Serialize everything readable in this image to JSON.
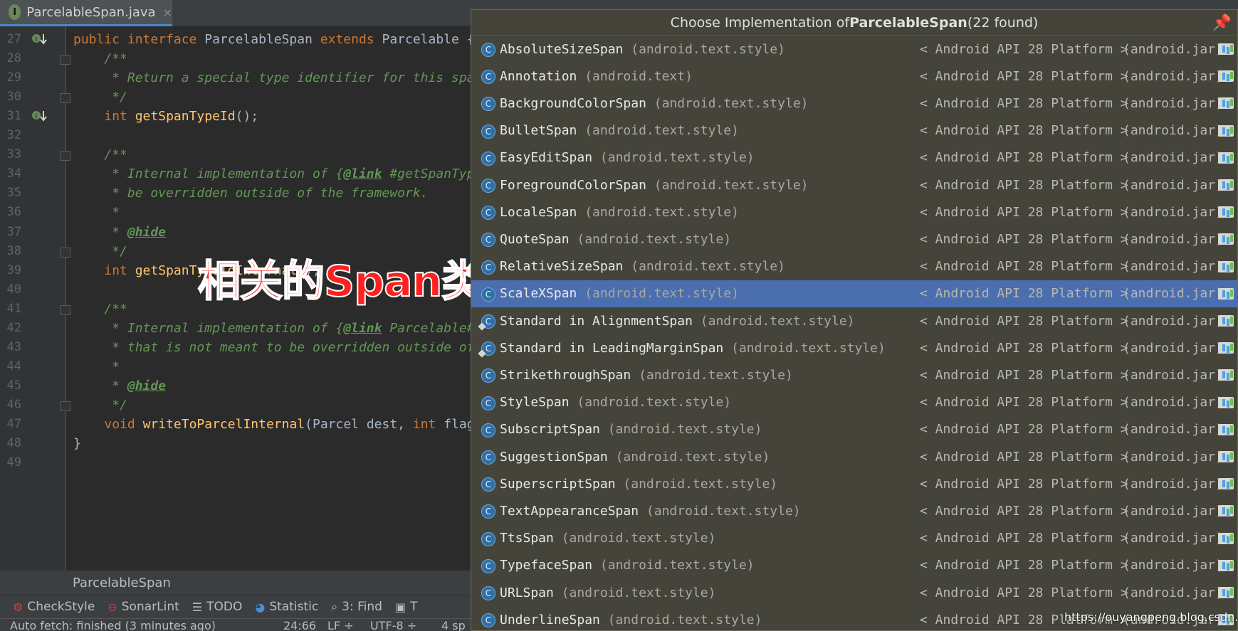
{
  "tab": {
    "file_name": "ParcelableSpan.java",
    "close": "×",
    "badge": "I"
  },
  "editor": {
    "lines": [
      {
        "n": "27",
        "html": "<span class=\"kw\">public interface</span> ParcelableSpan <span class=\"kw\">extends</span> Parcelable {"
      },
      {
        "n": "28",
        "html": "    <span class=\"cm\">/**</span>"
      },
      {
        "n": "29",
        "html": "     <span class=\"cm\">* Return a special type identifier for this span cl</span>"
      },
      {
        "n": "30",
        "html": "     <span class=\"cm\">*/</span>"
      },
      {
        "n": "31",
        "html": "    <span class=\"kw\">int</span> <span class=\"fn\">getSpanTypeId</span>();"
      },
      {
        "n": "32",
        "html": ""
      },
      {
        "n": "33",
        "html": "    <span class=\"cm\">/**</span>"
      },
      {
        "n": "34",
        "html": "     <span class=\"cm\">* Internal implementation of {</span><span class=\"tg\">@link</span> <span class=\"cm\">#getSpanTypeId(</span>"
      },
      {
        "n": "35",
        "html": "     <span class=\"cm\">* be overridden outside of the framework.</span>"
      },
      {
        "n": "36",
        "html": "     <span class=\"cm\">*</span>"
      },
      {
        "n": "37",
        "html": "     <span class=\"cm\">* </span><span class=\"tg\">@hide</span>"
      },
      {
        "n": "38",
        "html": "     <span class=\"cm\">*/</span>"
      },
      {
        "n": "39",
        "html": "    <span class=\"kw\">int</span> <span class=\"fn\">getSpanTypeIdInternal</span>();"
      },
      {
        "n": "40",
        "html": ""
      },
      {
        "n": "41",
        "html": "    <span class=\"cm\">/**</span>"
      },
      {
        "n": "42",
        "html": "     <span class=\"cm\">* Internal implementation of {</span><span class=\"tg\">@link</span> <span class=\"cm\">Parcelable#writ</span>"
      },
      {
        "n": "43",
        "html": "     <span class=\"cm\">* that is not meant to be overridden outside of the</span>"
      },
      {
        "n": "44",
        "html": "     <span class=\"cm\">*</span>"
      },
      {
        "n": "45",
        "html": "     <span class=\"cm\">* </span><span class=\"tg\">@hide</span>"
      },
      {
        "n": "46",
        "html": "     <span class=\"cm\">*/</span>"
      },
      {
        "n": "47",
        "html": "    <span class=\"kw\">void</span> <span class=\"fn\">writeToParcelInternal</span>(Parcel dest, <span class=\"kw\">int</span> flags);"
      },
      {
        "n": "48",
        "html": "}"
      },
      {
        "n": "49",
        "html": ""
      }
    ],
    "implemented_marker_lines": [
      "27",
      "31"
    ],
    "fold_lines": [
      "28",
      "30",
      "33",
      "38",
      "41",
      "46"
    ]
  },
  "overlay_text": "相关的Span类",
  "breadcrumb": "ParcelableSpan",
  "tool_windows": [
    {
      "icon": "checkstyle-icon",
      "glyph": "⚙",
      "color": "#d04040",
      "label": "CheckStyle"
    },
    {
      "icon": "sonarlint-icon",
      "glyph": "⊖",
      "color": "#e03030",
      "label": "SonarLint"
    },
    {
      "icon": "todo-icon",
      "glyph": "☰",
      "color": "#bbbbbb",
      "label": "TODO"
    },
    {
      "icon": "statistic-icon",
      "glyph": "◕",
      "color": "#4a90d9",
      "label": "Statistic"
    },
    {
      "icon": "find-icon",
      "glyph": "⌕",
      "color": "#bbbbbb",
      "label": "3: Find"
    },
    {
      "icon": "terminal-icon",
      "glyph": "▣",
      "color": "#bbbbbb",
      "label": "T"
    }
  ],
  "status": {
    "message": "Auto fetch: finished (3 minutes ago)",
    "position": "24:66",
    "line_sep": "LF ÷",
    "encoding": "UTF-8 ÷",
    "indent": "4 sp"
  },
  "popup": {
    "title_prefix": "Choose Implementation of ",
    "title_bold": "ParcelableSpan",
    "title_suffix": " (22 found)",
    "library": "< Android API 28 Platform >",
    "jar": "(android.jar)",
    "selected_index": 9,
    "items": [
      {
        "name": "AbsoluteSizeSpan",
        "pkg": "(android.text.style)"
      },
      {
        "name": "Annotation",
        "pkg": "(android.text)"
      },
      {
        "name": "BackgroundColorSpan",
        "pkg": "(android.text.style)"
      },
      {
        "name": "BulletSpan",
        "pkg": "(android.text.style)"
      },
      {
        "name": "EasyEditSpan",
        "pkg": "(android.text.style)"
      },
      {
        "name": "ForegroundColorSpan",
        "pkg": "(android.text.style)"
      },
      {
        "name": "LocaleSpan",
        "pkg": "(android.text.style)"
      },
      {
        "name": "QuoteSpan",
        "pkg": "(android.text.style)"
      },
      {
        "name": "RelativeSizeSpan",
        "pkg": "(android.text.style)"
      },
      {
        "name": "ScaleXSpan",
        "pkg": "(android.text.style)"
      },
      {
        "name": "Standard in AlignmentSpan",
        "pkg": "(android.text.style)",
        "overlay": true
      },
      {
        "name": "Standard in LeadingMarginSpan",
        "pkg": "(android.text.style)",
        "overlay": true
      },
      {
        "name": "StrikethroughSpan",
        "pkg": "(android.text.style)"
      },
      {
        "name": "StyleSpan",
        "pkg": "(android.text.style)"
      },
      {
        "name": "SubscriptSpan",
        "pkg": "(android.text.style)"
      },
      {
        "name": "SuggestionSpan",
        "pkg": "(android.text.style)"
      },
      {
        "name": "SuperscriptSpan",
        "pkg": "(android.text.style)"
      },
      {
        "name": "TextAppearanceSpan",
        "pkg": "(android.text.style)"
      },
      {
        "name": "TtsSpan",
        "pkg": "(android.text.style)"
      },
      {
        "name": "TypefaceSpan",
        "pkg": "(android.text.style)"
      },
      {
        "name": "URLSpan",
        "pkg": "(android.text.style)"
      },
      {
        "name": "UnderlineSpan",
        "pkg": "(android.text.style)"
      }
    ]
  },
  "watermark": "https://ouyangpeng.blog.csdn.net"
}
